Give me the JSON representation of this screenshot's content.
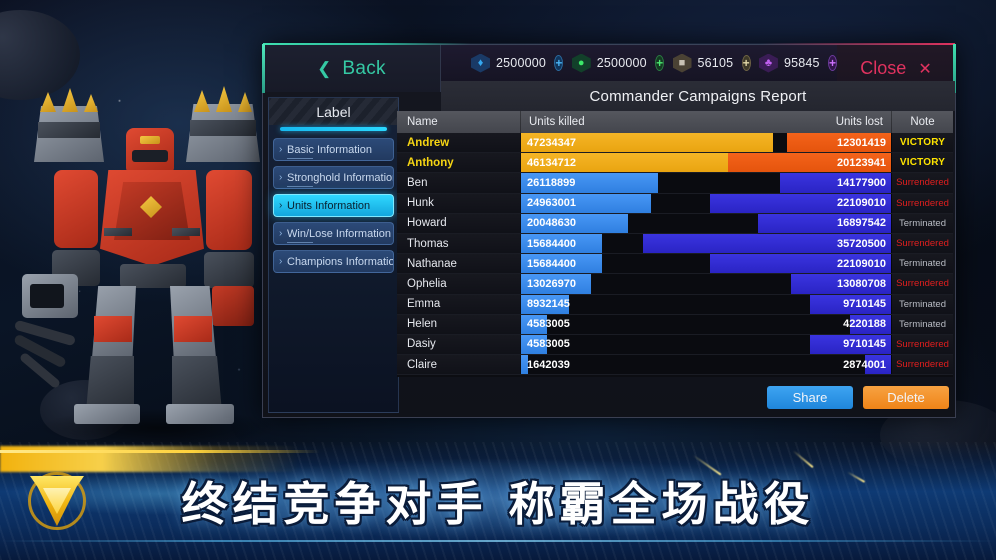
{
  "dialog": {
    "back_label": "Back",
    "back_icon": "chevron-left-icon",
    "title": "Commander Campaigns Report",
    "close_label": "Close",
    "close_icon": "close-x-icon"
  },
  "resources": [
    {
      "icon": "energy-hex-icon",
      "value": "2500000",
      "plus": "+"
    },
    {
      "icon": "gas-drop-hex-icon",
      "value": "2500000",
      "plus": "+"
    },
    {
      "icon": "metal-hex-icon",
      "value": "56105",
      "plus": "+"
    },
    {
      "icon": "crystal-hex-icon",
      "value": "95845",
      "plus": "+"
    }
  ],
  "sidebar": {
    "header": "Label",
    "items": [
      {
        "label": "Basic Information",
        "active": false
      },
      {
        "label": "Stronghold Information",
        "active": false
      },
      {
        "label": "Units Information",
        "active": true
      },
      {
        "label": "Win/Lose Information",
        "active": false
      },
      {
        "label": "Champions Information",
        "active": false
      }
    ]
  },
  "table": {
    "columns": {
      "name": "Name",
      "killed": "Units killed",
      "lost": "Units lost",
      "note": "Note"
    },
    "rows": [
      {
        "name": "Andrew",
        "killed": "47234347",
        "lost": "12301419",
        "note": "VICTORY",
        "note_kind": "victory",
        "killed_pct": 68,
        "lost_pct": 28,
        "style": "gold"
      },
      {
        "name": "Anthony",
        "killed": "46134712",
        "lost": "20123941",
        "note": "VICTORY",
        "note_kind": "victory",
        "killed_pct": 66,
        "lost_pct": 44,
        "style": "gold"
      },
      {
        "name": "Ben",
        "killed": "26118899",
        "lost": "14177900",
        "note": "Surrendered",
        "note_kind": "surrendered",
        "killed_pct": 37,
        "lost_pct": 30,
        "style": "blue"
      },
      {
        "name": "Hunk",
        "killed": "24963001",
        "lost": "22109010",
        "note": "Surrendered",
        "note_kind": "surrendered",
        "killed_pct": 35,
        "lost_pct": 49,
        "style": "blue"
      },
      {
        "name": "Howard",
        "killed": "20048630",
        "lost": "16897542",
        "note": "Terminated",
        "note_kind": "terminated",
        "killed_pct": 29,
        "lost_pct": 36,
        "style": "blue"
      },
      {
        "name": "Thomas",
        "killed": "15684400",
        "lost": "35720500",
        "note": "Surrendered",
        "note_kind": "surrendered",
        "killed_pct": 22,
        "lost_pct": 67,
        "style": "blue"
      },
      {
        "name": "Nathanae",
        "killed": "15684400",
        "lost": "22109010",
        "note": "Terminated",
        "note_kind": "terminated",
        "killed_pct": 22,
        "lost_pct": 49,
        "style": "blue"
      },
      {
        "name": "Ophelia",
        "killed": "13026970",
        "lost": "13080708",
        "note": "Surrendered",
        "note_kind": "surrendered",
        "killed_pct": 19,
        "lost_pct": 27,
        "style": "blue"
      },
      {
        "name": "Emma",
        "killed": "8932145",
        "lost": "9710145",
        "note": "Terminated",
        "note_kind": "terminated",
        "killed_pct": 13,
        "lost_pct": 22,
        "style": "blue"
      },
      {
        "name": "Helen",
        "killed": "4583005",
        "lost": "4220188",
        "note": "Terminated",
        "note_kind": "terminated",
        "killed_pct": 7,
        "lost_pct": 11,
        "style": "blue"
      },
      {
        "name": "Dasiy",
        "killed": "4583005",
        "lost": "9710145",
        "note": "Surrendered",
        "note_kind": "surrendered",
        "killed_pct": 7,
        "lost_pct": 22,
        "style": "blue"
      },
      {
        "name": "Claire",
        "killed": "1642039",
        "lost": "2874001",
        "note": "Surrendered",
        "note_kind": "surrendered",
        "killed_pct": 2,
        "lost_pct": 7,
        "style": "blue"
      }
    ]
  },
  "footer": {
    "share_label": "Share",
    "delete_label": "Delete"
  },
  "banner": {
    "text": "终结竞争对手  称霸全场战役",
    "emblem_icon": "faction-triangle-emblem-icon"
  },
  "colors": {
    "accent_teal": "#35c9a4",
    "accent_cyan": "#2fd8ff",
    "close_red": "#e0325f",
    "killed_gold": "#f5b526",
    "killed_blue": "#4897f5",
    "lost_orange": "#f4631a",
    "lost_indigo": "#3a34e0",
    "victory_yellow": "#ffe500",
    "surrendered_red": "#e01e1e",
    "terminated_gray": "#b9bcc4",
    "share_blue": "#3ea4f2",
    "delete_orange": "#f7a242"
  }
}
